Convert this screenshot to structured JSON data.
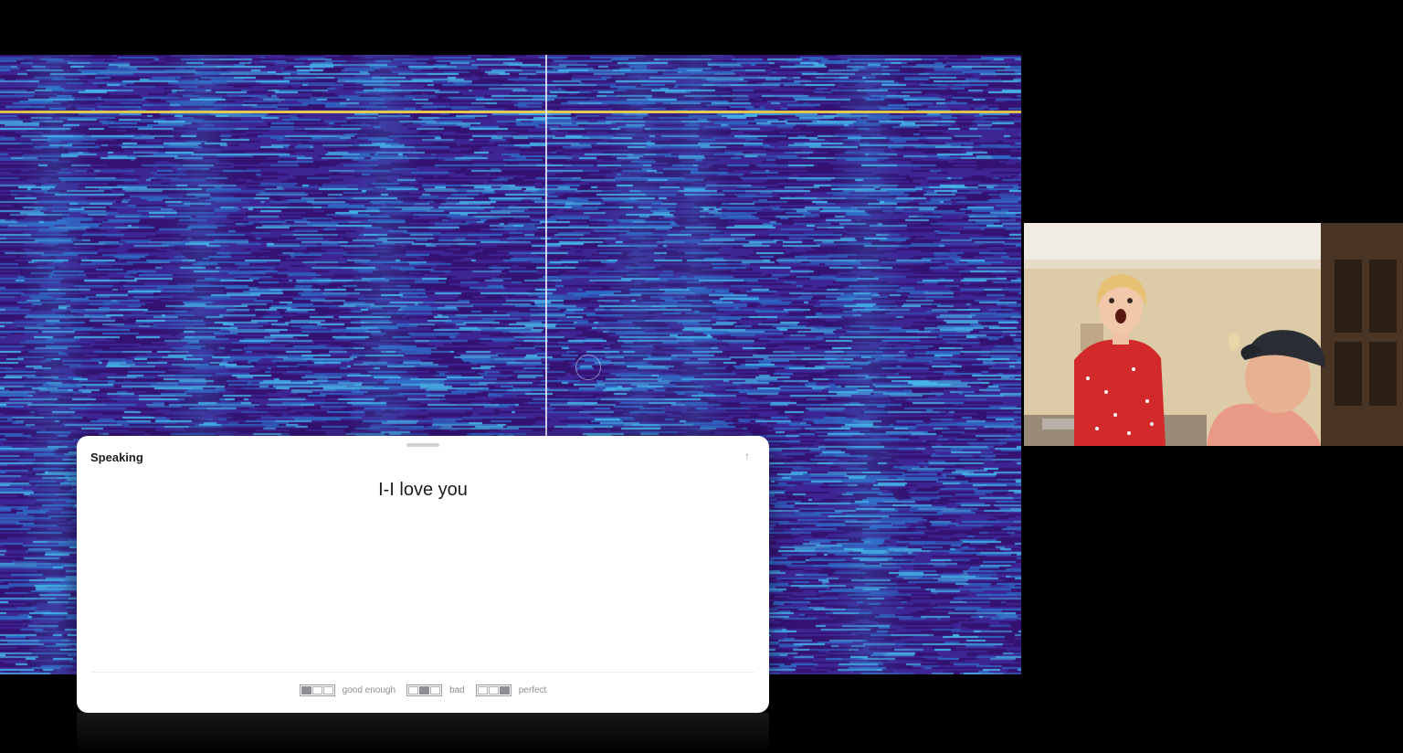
{
  "panel": {
    "title": "Speaking",
    "transcript": "I-I love you",
    "expand_icon": "arrow-up-icon",
    "ratings": [
      {
        "label": "good enough",
        "level": "1 of 3"
      },
      {
        "label": "bad",
        "level": "2 of 3"
      },
      {
        "label": "perfect",
        "level": "3 of 3"
      }
    ]
  },
  "colors": {
    "spectrogram_base": "#3b1a86",
    "spectrogram_highlight": "#3fb0e8",
    "marker_line": "#f0d24f",
    "panel_background": "#ffffff"
  }
}
